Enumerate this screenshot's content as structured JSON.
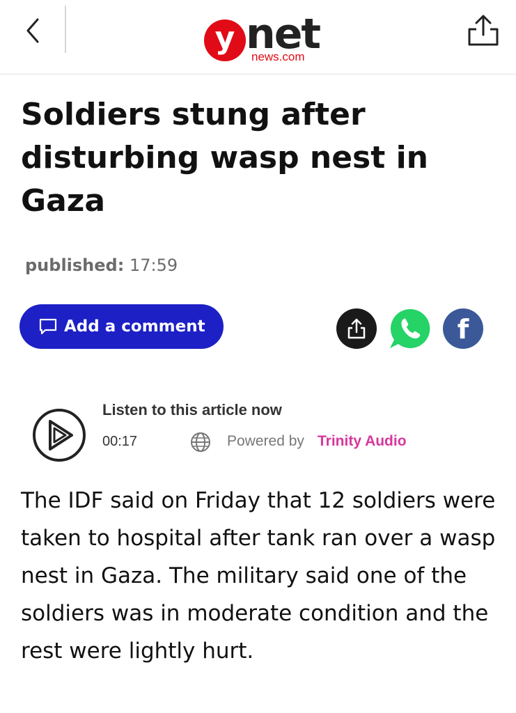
{
  "header": {
    "back_icon": "chevron-left-icon",
    "logo_letter": "y",
    "logo_word": "net",
    "logo_sub": "news.com",
    "share_icon": "share-upload-icon",
    "brand_color": "#e10b17"
  },
  "article": {
    "title": "Soldiers stung after disturbing wasp nest in Gaza",
    "published_label": "published:",
    "published_time": "17:59",
    "body": "The IDF said on Friday that 12 soldiers were taken to hospital after tank ran over a wasp nest in Gaza. The military said one of the soldiers was in moderate condition and the rest were lightly hurt."
  },
  "actions": {
    "comment_label": "Add a comment",
    "comment_icon": "comment-icon",
    "comment_color": "#1c20c5",
    "share_icon": "share-icon",
    "whatsapp_icon": "whatsapp-icon",
    "facebook_icon": "facebook-icon",
    "facebook_letter": "f"
  },
  "audio": {
    "title": "Listen to this article now",
    "time": "00:17",
    "powered_label": "Powered by",
    "provider": "Trinity Audio",
    "provider_color": "#d6389c"
  }
}
